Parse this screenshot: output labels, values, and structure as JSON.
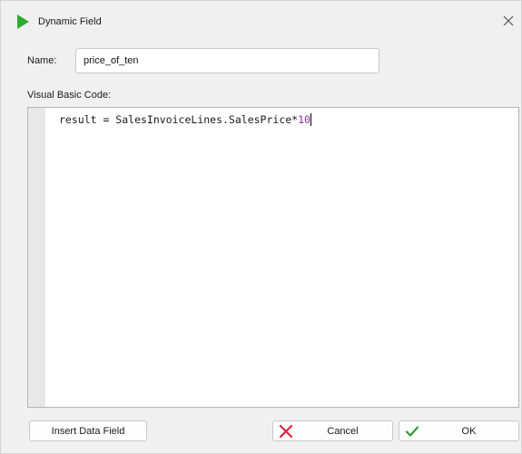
{
  "window": {
    "title": "Dynamic Field",
    "app_icon": "green-play-icon",
    "close_icon": "close-icon"
  },
  "form": {
    "name_label": "Name:",
    "name_value": "price_of_ten",
    "code_label": "Visual Basic Code:",
    "code_text": "result = SalesInvoiceLines.SalesPrice*",
    "code_number": "10"
  },
  "buttons": {
    "insert_label": "Insert Data Field",
    "cancel_label": "Cancel",
    "cancel_icon": "red-x-icon",
    "ok_label": "OK",
    "ok_icon": "green-check-icon"
  },
  "colors": {
    "app_icon": "#2faa2f",
    "cancel_icon": "#d9263f",
    "ok_icon": "#2e9e34",
    "code_number": "#8b2fa0"
  }
}
